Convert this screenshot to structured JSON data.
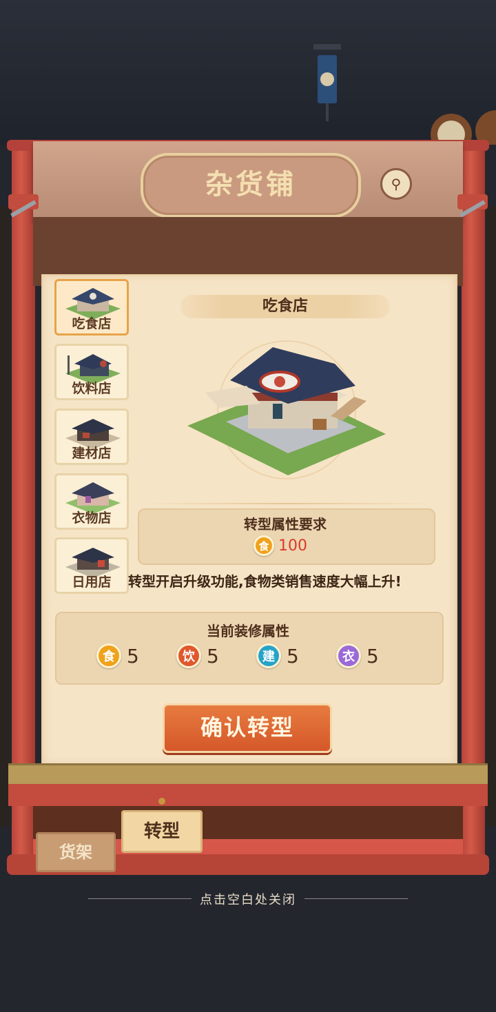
{
  "header": {
    "title": "杂货铺",
    "help_icon": "help-lantern-icon"
  },
  "categories": [
    {
      "label": "吃食店",
      "selected": true
    },
    {
      "label": "饮料店",
      "selected": false
    },
    {
      "label": "建材店",
      "selected": false
    },
    {
      "label": "衣物店",
      "selected": false
    },
    {
      "label": "日用店",
      "selected": false
    }
  ],
  "detail": {
    "shop_name": "吃食店",
    "requirement_title": "转型属性要求",
    "requirement": {
      "icon_char": "食",
      "value": "100"
    },
    "description": "转型开启升级功能,食物类销售速度大幅上升!",
    "current_title": "当前装修属性",
    "attributes": [
      {
        "char": "食",
        "value": "5",
        "color": "#f0a21c"
      },
      {
        "char": "饮",
        "value": "5",
        "color": "#e0582c"
      },
      {
        "char": "建",
        "value": "5",
        "color": "#27a3c9"
      },
      {
        "char": "衣",
        "value": "5",
        "color": "#9b6ad8"
      }
    ],
    "confirm_label": "确认转型"
  },
  "tabs": {
    "active": "转型",
    "inactive": "货架"
  },
  "close_hint": "点击空白处关闭",
  "colors": {
    "accent": "#d5582a",
    "frame_red": "#c34c3e",
    "panel": "#f6e4c6"
  }
}
